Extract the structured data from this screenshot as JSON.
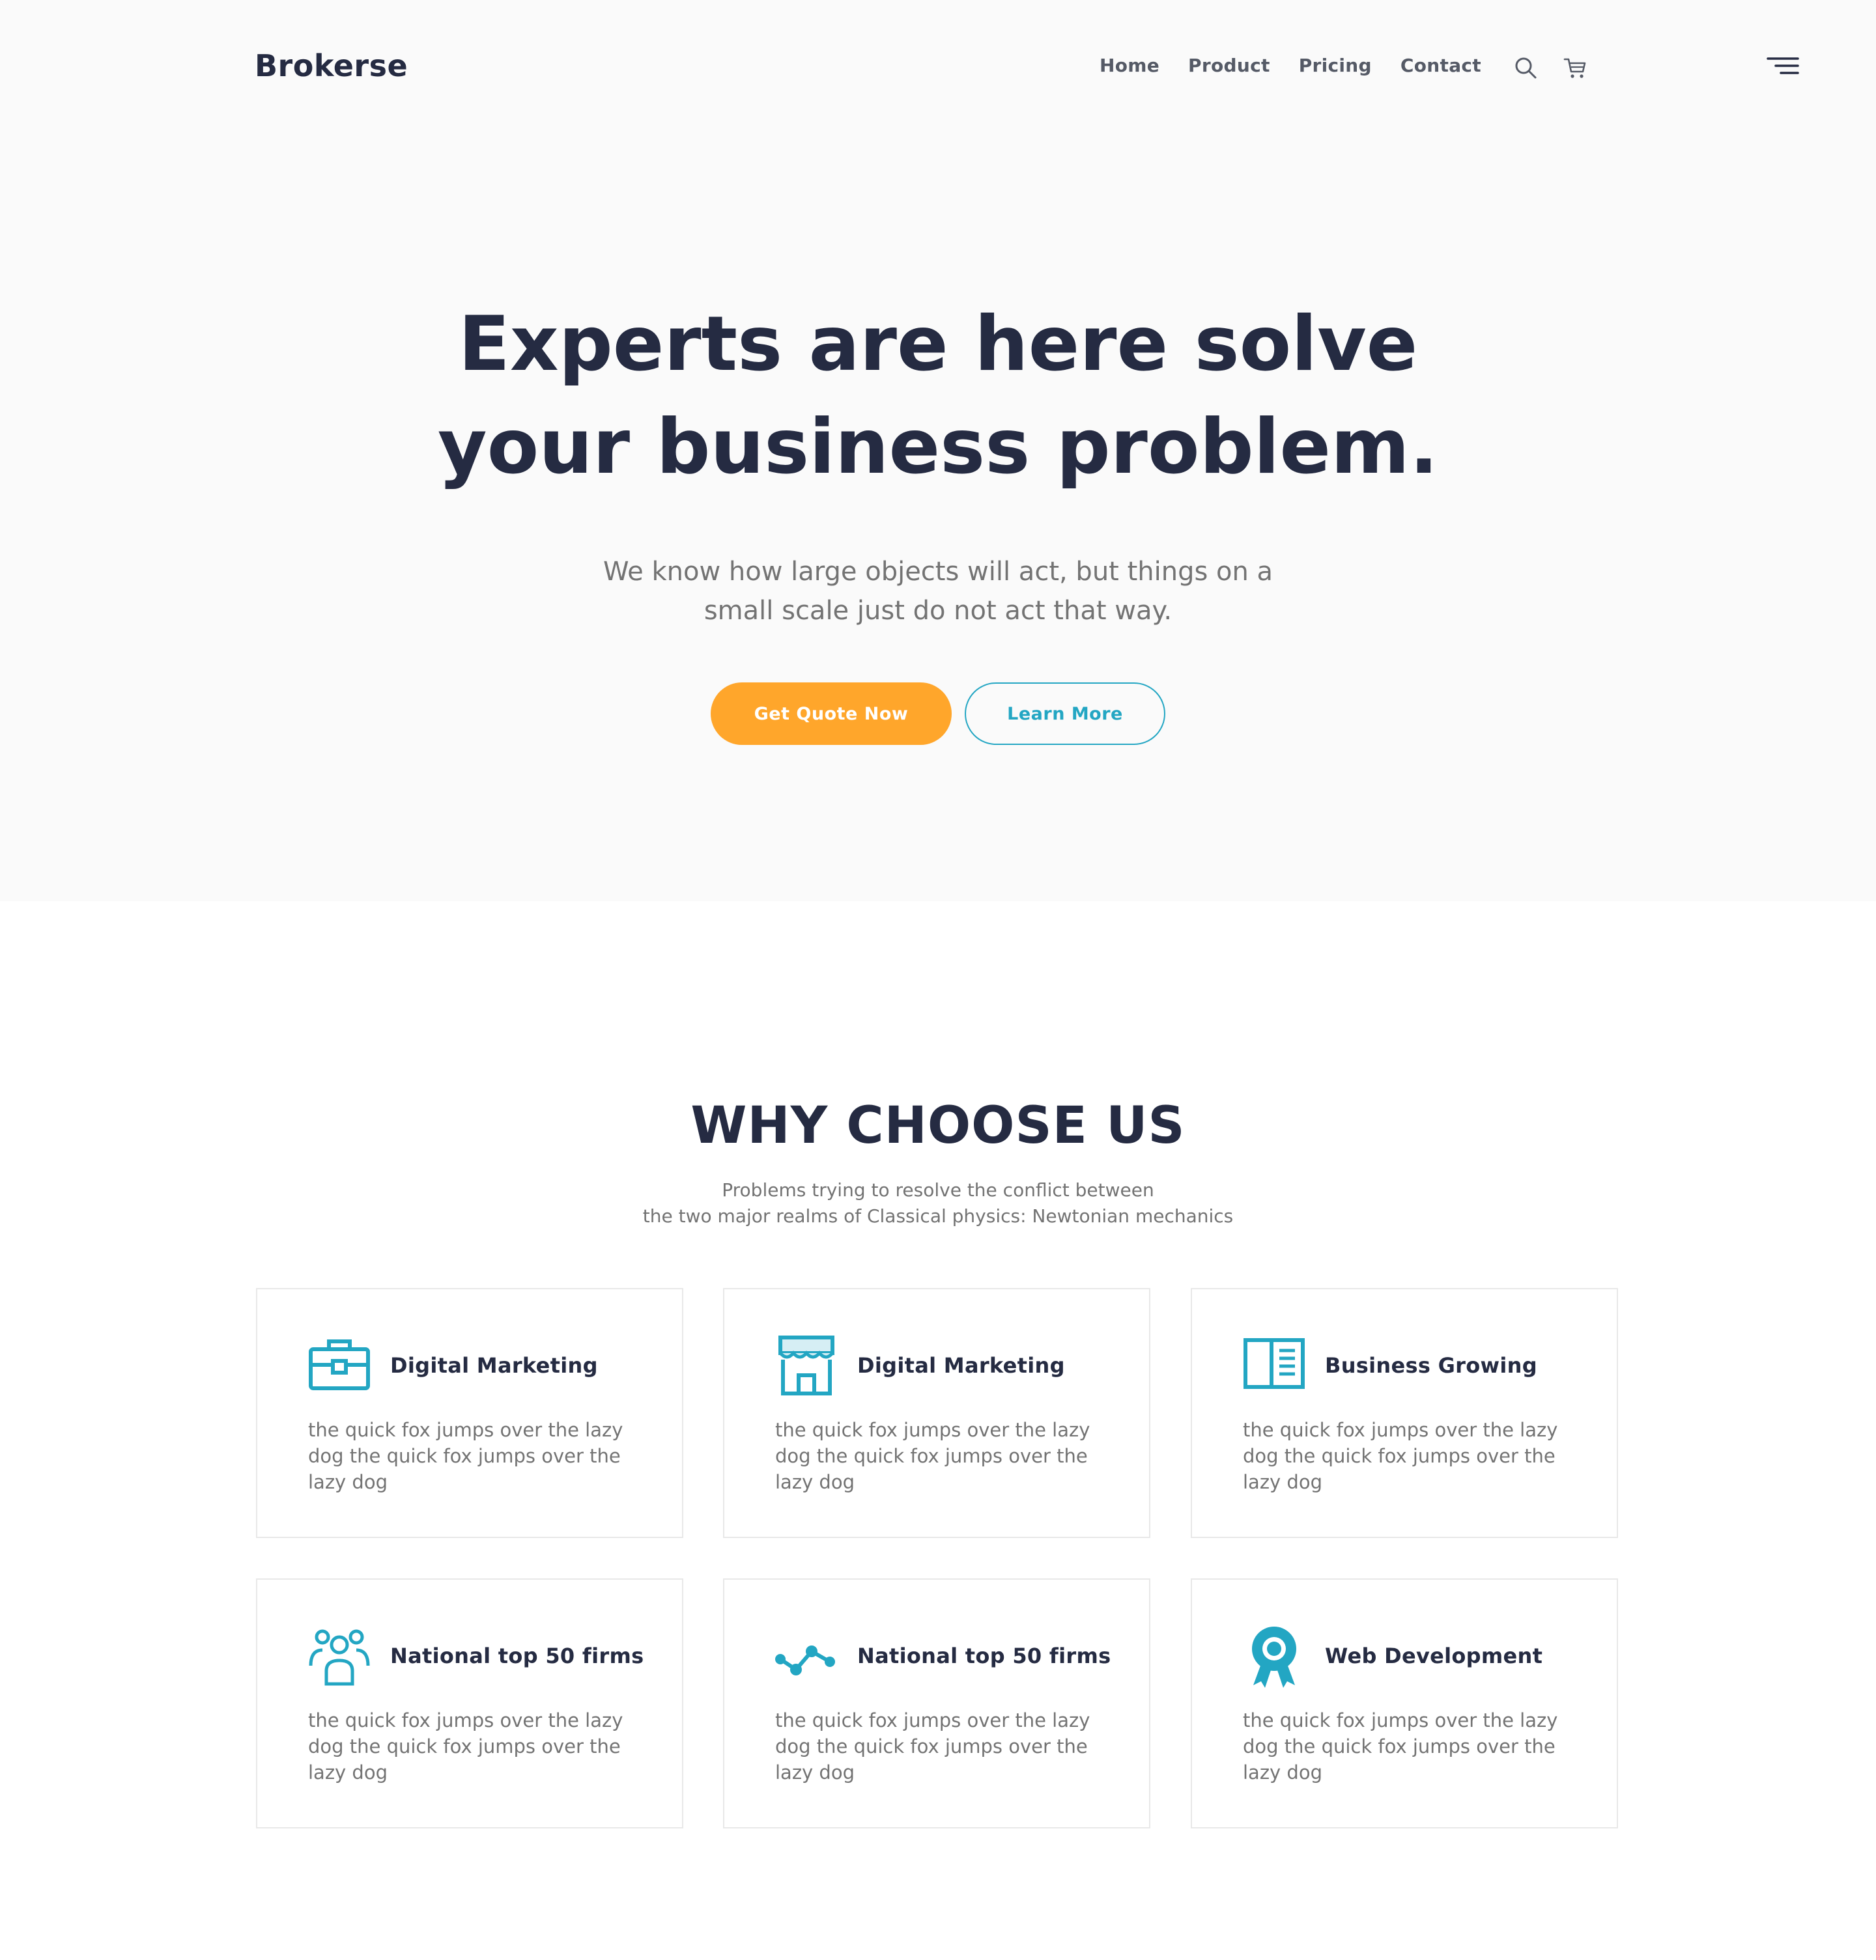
{
  "header": {
    "brand": "Brokerse",
    "nav": [
      "Home",
      "Product",
      "Pricing",
      "Contact"
    ],
    "icons": [
      "search-icon",
      "cart-icon",
      "menu-icon"
    ]
  },
  "hero": {
    "title_lines": [
      "Experts are here solve",
      "your business problem."
    ],
    "subtitle_lines": [
      "We know how large objects will act, but things on a",
      "small scale just do not act that way."
    ],
    "primary_button": "Get Quote Now",
    "secondary_button": "Learn More"
  },
  "features": {
    "title": "WHY CHOOSE US",
    "subtitle_lines": [
      "Problems trying to resolve the conflict between",
      "the two major realms of Classical physics: Newtonian mechanics"
    ],
    "cards": [
      {
        "icon": "briefcase-icon",
        "title": "Digital Marketing",
        "text": "the quick fox jumps over the lazy dog the quick fox jumps over the lazy dog"
      },
      {
        "icon": "storefront-icon",
        "title": "Digital Marketing",
        "text": "the quick fox jumps over the lazy dog the quick fox jumps over the lazy dog"
      },
      {
        "icon": "book-icon",
        "title": "Business Growing",
        "text": "the quick fox jumps over the lazy dog the quick fox jumps over the lazy dog"
      },
      {
        "icon": "team-icon",
        "title": "National top 50 firms",
        "text": "the quick fox jumps over the lazy dog the quick fox jumps over the lazy dog"
      },
      {
        "icon": "trend-line-icon",
        "title": "National top 50 firms",
        "text": "the quick fox jumps over the lazy dog the quick fox jumps over the lazy dog"
      },
      {
        "icon": "award-ribbon-icon",
        "title": "Web Development",
        "text": "the quick fox jumps over the lazy dog the quick fox jumps over the lazy dog"
      }
    ]
  },
  "colors": {
    "primary_text": "#252b42",
    "muted_text": "#737373",
    "accent_blue": "#23a6c3",
    "accent_orange": "#ffa62b",
    "hero_bg": "#fafafa"
  }
}
